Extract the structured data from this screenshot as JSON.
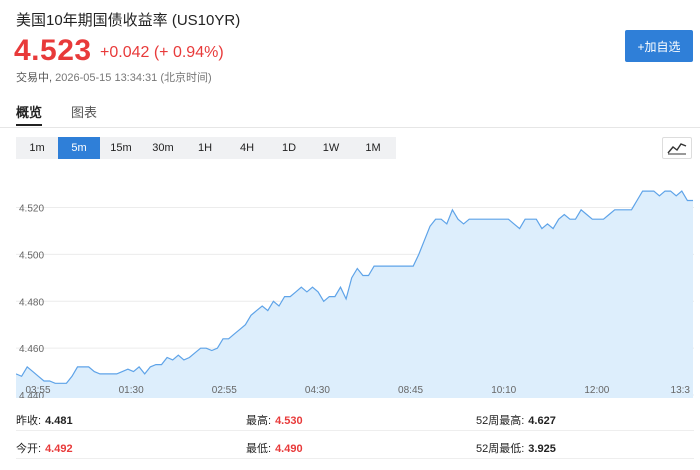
{
  "header": {
    "title": "美国10年期国债收益率 (US10YR)",
    "price": "4.523",
    "change": "+0.042 (+ 0.94%)",
    "status_label": "交易中,",
    "timestamp": "2026-05-15 13:34:31 (北京时间)",
    "watch_button": "+加自选",
    "up_color": "#e83a3a",
    "accent_color": "#2f7fd8"
  },
  "tabs": [
    {
      "label": "概览",
      "active": true
    },
    {
      "label": "图表",
      "active": false
    }
  ],
  "ranges": [
    {
      "label": "1m",
      "active": false
    },
    {
      "label": "5m",
      "active": true
    },
    {
      "label": "15m",
      "active": false
    },
    {
      "label": "30m",
      "active": false
    },
    {
      "label": "1H",
      "active": false
    },
    {
      "label": "4H",
      "active": false
    },
    {
      "label": "1D",
      "active": false
    },
    {
      "label": "1W",
      "active": false
    },
    {
      "label": "1M",
      "active": false
    }
  ],
  "chart_type_icon": "line-chart-icon",
  "chart_data": {
    "type": "area",
    "ylim": [
      4.443,
      4.536
    ],
    "yticks": [
      "4.520",
      "4.500",
      "4.480",
      "4.460",
      "4.440"
    ],
    "ytick_values": [
      4.52,
      4.5,
      4.48,
      4.46,
      4.44
    ],
    "xticks": [
      "03:55",
      "01:30",
      "02:55",
      "04:30",
      "08:45",
      "10:10",
      "12:00",
      "13:3"
    ],
    "grid": true,
    "line_color": "#5ea3e8",
    "fill_color": "#ddeefc",
    "values": [
      4.449,
      4.448,
      4.452,
      4.45,
      4.448,
      4.446,
      4.446,
      4.445,
      4.445,
      4.445,
      4.448,
      4.452,
      4.452,
      4.452,
      4.45,
      4.449,
      4.449,
      4.449,
      4.449,
      4.45,
      4.451,
      4.45,
      4.452,
      4.449,
      4.452,
      4.453,
      4.453,
      4.456,
      4.455,
      4.457,
      4.455,
      4.456,
      4.458,
      4.46,
      4.46,
      4.459,
      4.46,
      4.464,
      4.464,
      4.466,
      4.468,
      4.47,
      4.474,
      4.476,
      4.478,
      4.476,
      4.48,
      4.478,
      4.482,
      4.482,
      4.484,
      4.486,
      4.484,
      4.486,
      4.484,
      4.48,
      4.482,
      4.482,
      4.486,
      4.481,
      4.49,
      4.494,
      4.491,
      4.491,
      4.495,
      4.495,
      4.495,
      4.495,
      4.495,
      4.495,
      4.495,
      4.495,
      4.5,
      4.506,
      4.512,
      4.515,
      4.515,
      4.513,
      4.519,
      4.515,
      4.513,
      4.515,
      4.515,
      4.515,
      4.515,
      4.515,
      4.515,
      4.515,
      4.515,
      4.513,
      4.511,
      4.515,
      4.515,
      4.515,
      4.511,
      4.513,
      4.511,
      4.515,
      4.517,
      4.515,
      4.515,
      4.519,
      4.517,
      4.515,
      4.515,
      4.515,
      4.517,
      4.519,
      4.519,
      4.519,
      4.519,
      4.523,
      4.527,
      4.527,
      4.527,
      4.525,
      4.527,
      4.527,
      4.525,
      4.527,
      4.523,
      4.523
    ]
  },
  "stats": {
    "prev_close_label": "昨收:",
    "prev_close": "4.481",
    "open_label": "今开:",
    "open": "4.492",
    "high_label": "最高:",
    "high": "4.530",
    "low_label": "最低:",
    "low": "4.490",
    "wk52_high_label": "52周最高:",
    "wk52_high": "4.627",
    "wk52_low_label": "52周最低:",
    "wk52_low": "3.925"
  }
}
